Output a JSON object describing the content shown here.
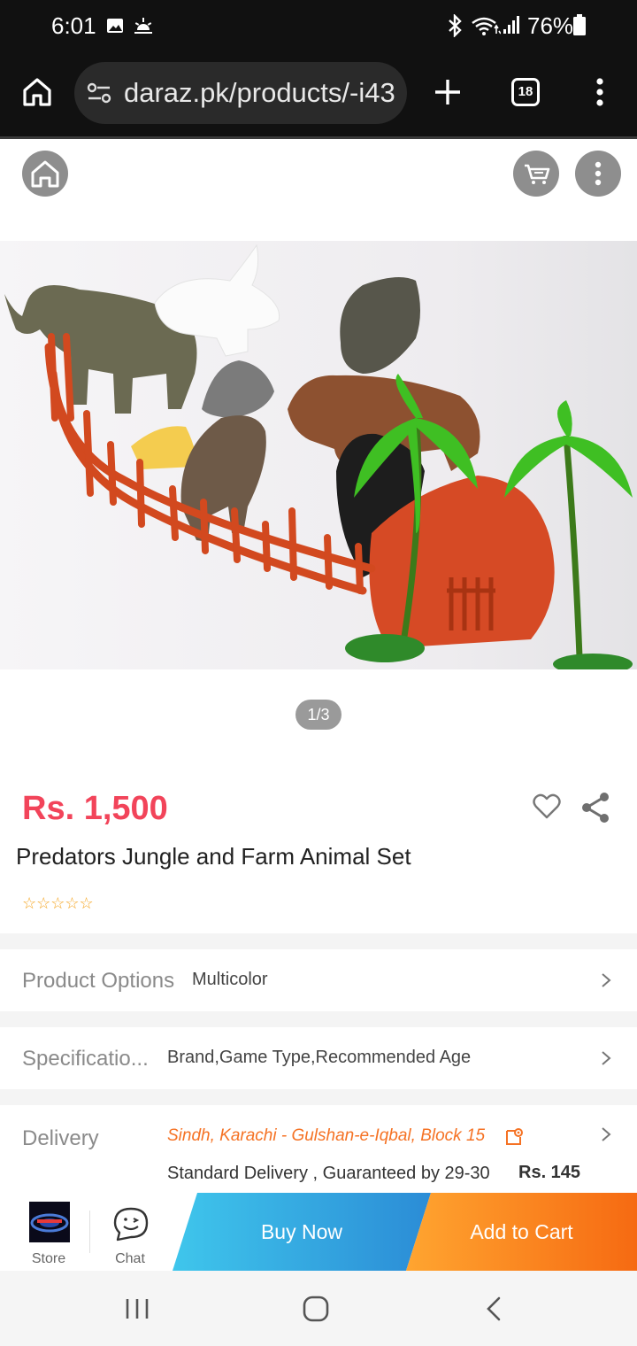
{
  "status_bar": {
    "time": "6:01",
    "battery": "76%"
  },
  "browser": {
    "url": "daraz.pk/products/-i43",
    "tab_count": "18"
  },
  "product": {
    "image_counter": "1/3",
    "price": "Rs. 1,500",
    "title": "Predators Jungle and Farm Animal Set",
    "rating_stars": "☆☆☆☆☆",
    "rating_value": 0
  },
  "details": {
    "options_label": "Product Options",
    "options_value": "Multicolor",
    "spec_label": "Specificatio...",
    "spec_value": "Brand,Game Type,Recommended Age",
    "delivery_label": "Delivery",
    "delivery_location": "Sindh, Karachi - Gulshan-e-Iqbal, Block 15",
    "delivery_option": "Standard Delivery , Guaranteed by 29-30",
    "delivery_fee": "Rs. 145"
  },
  "action_bar": {
    "store_label": "Store",
    "chat_label": "Chat",
    "buy_now_label": "Buy Now",
    "add_to_cart_label": "Add to Cart"
  },
  "colors": {
    "price": "#f2445a",
    "accent_orange": "#f57224",
    "buy_now": "#2b8cd6",
    "add_to_cart": "#f66a12"
  },
  "icons": [
    "gallery-icon",
    "weather-icon",
    "bluetooth-icon",
    "wifi-icon",
    "signal-icon",
    "battery-icon",
    "home-icon",
    "site-settings-icon",
    "plus-icon",
    "tab-switcher-icon",
    "kebab-menu-icon",
    "cart-icon",
    "heart-icon",
    "share-icon",
    "chevron-right-icon",
    "location-edit-icon",
    "chat-icon",
    "recents-icon",
    "nav-home-icon",
    "back-icon"
  ]
}
